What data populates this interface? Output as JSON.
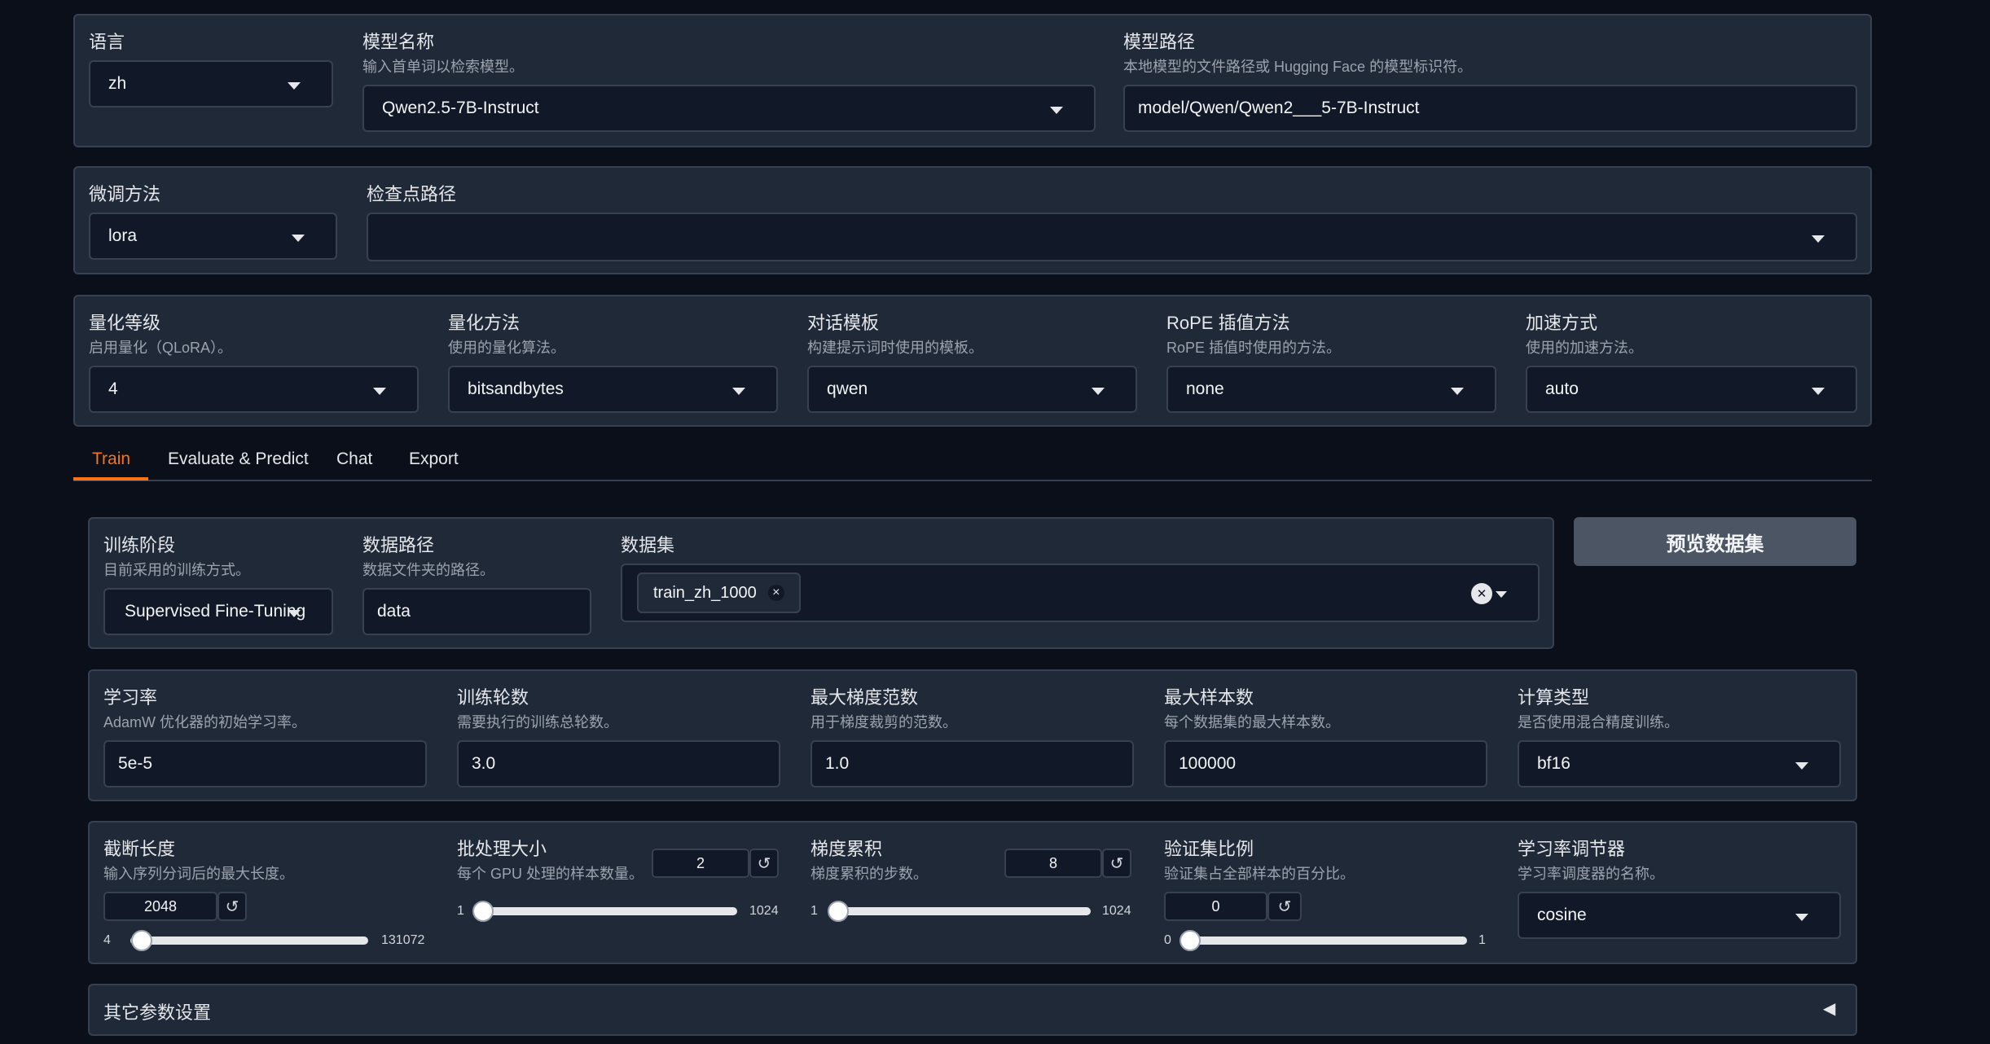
{
  "top": {
    "language": {
      "label": "语言",
      "value": "zh"
    },
    "model_name": {
      "label": "模型名称",
      "info": "输入首单词以检索模型。",
      "value": "Qwen2.5-7B-Instruct"
    },
    "model_path": {
      "label": "模型路径",
      "info": "本地模型的文件路径或 Hugging Face 的模型标识符。",
      "value": "model/Qwen/Qwen2___5-7B-Instruct"
    },
    "finetune": {
      "label": "微调方法",
      "value": "lora"
    },
    "checkpoint": {
      "label": "检查点路径",
      "value": ""
    },
    "quant_bit": {
      "label": "量化等级",
      "info": "启用量化（QLoRA）。",
      "value": "4"
    },
    "quant_method": {
      "label": "量化方法",
      "info": "使用的量化算法。",
      "value": "bitsandbytes"
    },
    "template": {
      "label": "对话模板",
      "info": "构建提示词时使用的模板。",
      "value": "qwen"
    },
    "rope": {
      "label": "RoPE 插值方法",
      "info": "RoPE 插值时使用的方法。",
      "value": "none"
    },
    "booster": {
      "label": "加速方式",
      "info": "使用的加速方法。",
      "value": "auto"
    }
  },
  "tabs": [
    "Train",
    "Evaluate & Predict",
    "Chat",
    "Export"
  ],
  "active_tab_color": "#f97316",
  "train": {
    "stage": {
      "label": "训练阶段",
      "info": "目前采用的训练方式。",
      "value": "Supervised Fine-Tuning"
    },
    "dataset_dir": {
      "label": "数据路径",
      "info": "数据文件夹的路径。",
      "value": "data"
    },
    "dataset": {
      "label": "数据集",
      "selected": [
        "train_zh_1000"
      ]
    },
    "preview_button": "预览数据集",
    "learning_rate": {
      "label": "学习率",
      "info": "AdamW 优化器的初始学习率。",
      "value": "5e-5"
    },
    "epochs": {
      "label": "训练轮数",
      "info": "需要执行的训练总轮数。",
      "value": "3.0"
    },
    "max_grad_norm": {
      "label": "最大梯度范数",
      "info": "用于梯度裁剪的范数。",
      "value": "1.0"
    },
    "max_samples": {
      "label": "最大样本数",
      "info": "每个数据集的最大样本数。",
      "value": "100000"
    },
    "compute_type": {
      "label": "计算类型",
      "info": "是否使用混合精度训练。",
      "value": "bf16"
    },
    "cutoff_len": {
      "label": "截断长度",
      "info": "输入序列分词后的最大长度。",
      "value": "2048",
      "min": "4",
      "max": "131072",
      "fraction": 0.015
    },
    "batch_size": {
      "label": "批处理大小",
      "info": "每个 GPU 处理的样本数量。",
      "value": "2",
      "min": "1",
      "max": "1024",
      "fraction": 0.001
    },
    "grad_accum": {
      "label": "梯度累积",
      "info": "梯度累积的步数。",
      "value": "8",
      "min": "1",
      "max": "1024",
      "fraction": 0.007
    },
    "val_size": {
      "label": "验证集比例",
      "info": "验证集占全部样本的百分比。",
      "value": "0",
      "min": "0",
      "max": "1",
      "fraction": 0
    },
    "scheduler": {
      "label": "学习率调节器",
      "info": "学习率调度器的名称。",
      "value": "cosine"
    },
    "extra": "其它参数设置"
  },
  "reset_glyph": "↺",
  "remove_glyph": "×",
  "clear_glyph": "✕",
  "collapse_glyph": "◀"
}
